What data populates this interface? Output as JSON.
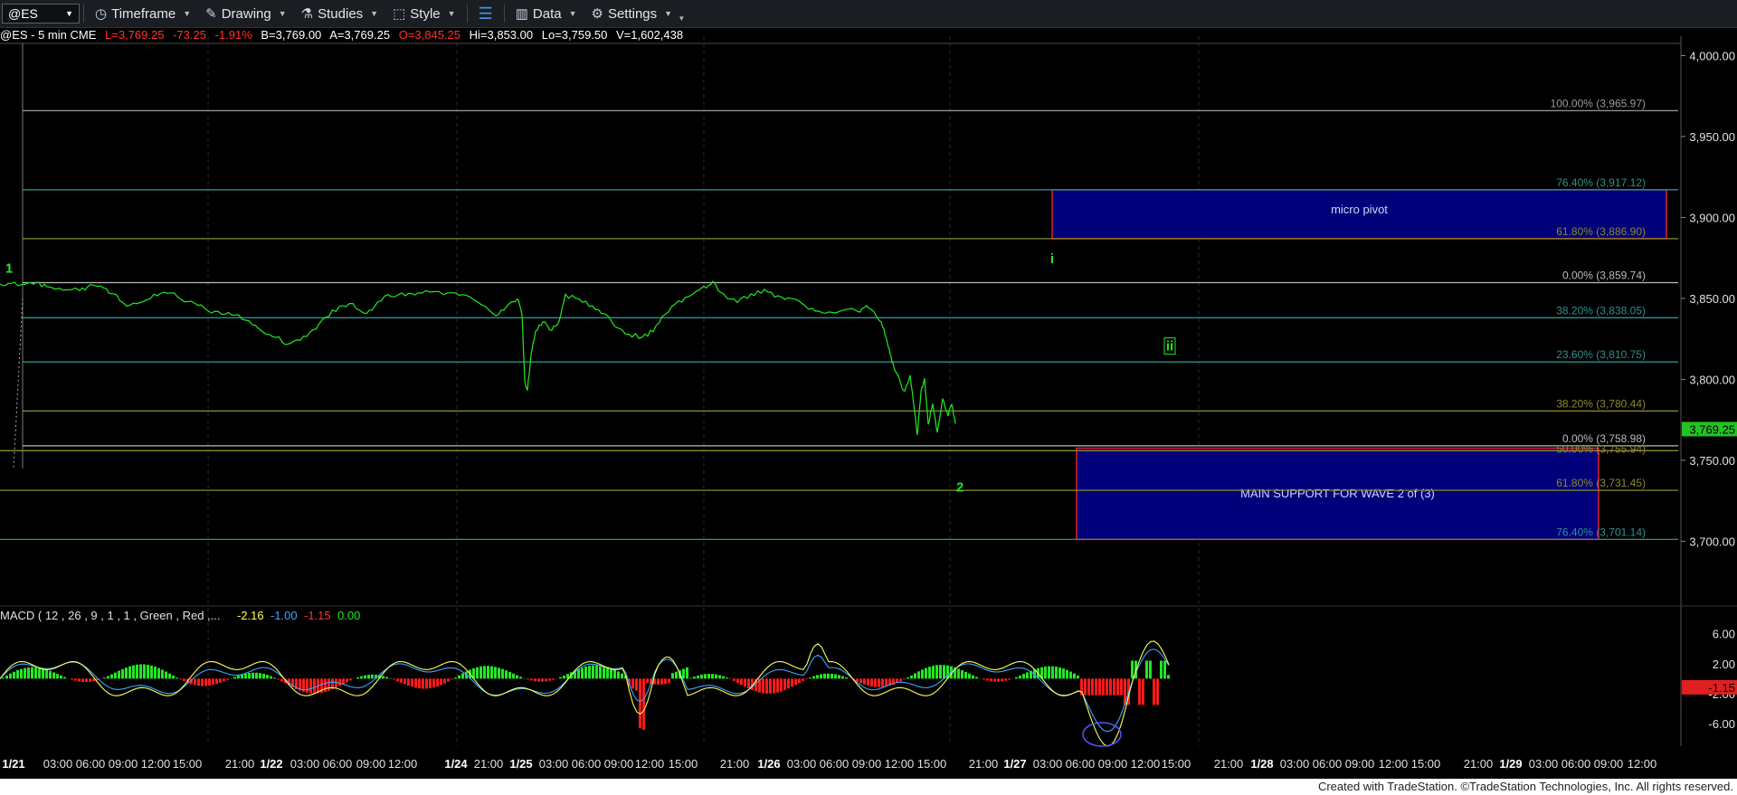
{
  "toolbar": {
    "symbol": "@ES",
    "items": [
      {
        "label": "Timeframe",
        "icon": "clock-icon"
      },
      {
        "label": "Drawing",
        "icon": "pencil-icon"
      },
      {
        "label": "Studies",
        "icon": "flask-icon"
      },
      {
        "label": "Style",
        "icon": "style-icon"
      },
      {
        "label": "Data",
        "icon": "bar-data-icon"
      },
      {
        "label": "Settings",
        "icon": "gear-icon"
      }
    ]
  },
  "status": {
    "title": "@ES - 5 min  CME",
    "last": "L=3,769.25",
    "change": "-73.25",
    "pct": "-1.91%",
    "bid": "B=3,769.00",
    "ask": "A=3,769.25",
    "open": "O=3,845.25",
    "high": "Hi=3,853.00",
    "low": "Lo=3,759.50",
    "volume": "V=1,602,438"
  },
  "colors": {
    "price_line": "#22e822",
    "macd_line": "#ffff55",
    "signal_line": "#3aa6ff",
    "hist_pos": "#22e822",
    "hist_neg": "#ff1a1a",
    "box_fill": "#00008b",
    "box_border": "#e0202a",
    "fib_teal": "#2f8f8f",
    "fib_olive": "#8a8a30"
  },
  "chart_data": {
    "type": "line",
    "title": "@ES - 5 min  CME",
    "ylim": [
      3660,
      4012
    ],
    "y_ticks": [
      "4,000.00",
      "3,950.00",
      "3,900.00",
      "3,850.00",
      "3,800.00",
      "3,750.00",
      "3,700.00"
    ],
    "y_tick_values": [
      4000,
      3950,
      3900,
      3850,
      3800,
      3750,
      3700
    ],
    "last_price_label": "3,769.25",
    "x_tick_labels": [
      "1/21",
      "03:00",
      "06:00",
      "09:00",
      "12:00",
      "15:00",
      "21:00",
      "1/22",
      "03:00",
      "06:00",
      "09:00",
      "12:00",
      "1/24",
      "21:00",
      "1/25",
      "03:00",
      "06:00",
      "09:00",
      "12:00",
      "15:00",
      "21:00",
      "1/26",
      "03:00",
      "06:00",
      "09:00",
      "12:00",
      "15:00",
      "21:00",
      "1/27",
      "03:00",
      "06:00",
      "09:00",
      "12:00",
      "15:00",
      "21:00",
      "1/28",
      "03:00",
      "06:00",
      "09:00",
      "12:00",
      "15:00",
      "21:00",
      "1/29",
      "03:00",
      "06:00",
      "09:00",
      "12:00"
    ],
    "series": [
      {
        "values": [
          [
            0,
            3858
          ],
          [
            12,
            3860
          ],
          [
            28,
            3858
          ],
          [
            40,
            3860
          ],
          [
            52,
            3857
          ],
          [
            70,
            3855
          ],
          [
            88,
            3855
          ],
          [
            100,
            3858
          ],
          [
            115,
            3856
          ],
          [
            125,
            3853
          ],
          [
            140,
            3846
          ],
          [
            155,
            3848
          ],
          [
            170,
            3852
          ],
          [
            185,
            3854
          ],
          [
            200,
            3850
          ],
          [
            215,
            3847
          ],
          [
            230,
            3843
          ],
          [
            245,
            3840
          ],
          [
            260,
            3840
          ],
          [
            275,
            3836
          ],
          [
            290,
            3830
          ],
          [
            305,
            3826
          ],
          [
            318,
            3822
          ],
          [
            332,
            3824
          ],
          [
            346,
            3830
          ],
          [
            360,
            3838
          ],
          [
            375,
            3845
          ],
          [
            390,
            3846
          ],
          [
            405,
            3840
          ],
          [
            418,
            3848
          ],
          [
            432,
            3852
          ],
          [
            448,
            3852
          ],
          [
            462,
            3853
          ],
          [
            480,
            3854
          ],
          [
            500,
            3853
          ],
          [
            515,
            3852
          ],
          [
            532,
            3847
          ],
          [
            548,
            3840
          ],
          [
            560,
            3845
          ],
          [
            572,
            3850
          ],
          [
            577,
            3840
          ],
          [
            580,
            3800
          ],
          [
            583,
            3793
          ],
          [
            587,
            3815
          ],
          [
            592,
            3830
          ],
          [
            600,
            3836
          ],
          [
            610,
            3830
          ],
          [
            618,
            3836
          ],
          [
            625,
            3852
          ],
          [
            640,
            3849
          ],
          [
            655,
            3845
          ],
          [
            668,
            3840
          ],
          [
            680,
            3833
          ],
          [
            695,
            3828
          ],
          [
            710,
            3826
          ],
          [
            722,
            3830
          ],
          [
            735,
            3840
          ],
          [
            750,
            3848
          ],
          [
            765,
            3852
          ],
          [
            778,
            3857
          ],
          [
            788,
            3860
          ],
          [
            800,
            3852
          ],
          [
            815,
            3848
          ],
          [
            830,
            3852
          ],
          [
            845,
            3855
          ],
          [
            860,
            3851
          ],
          [
            875,
            3850
          ],
          [
            890,
            3845
          ],
          [
            905,
            3842
          ],
          [
            920,
            3841
          ],
          [
            935,
            3843
          ],
          [
            948,
            3842
          ],
          [
            958,
            3845
          ],
          [
            966,
            3841
          ],
          [
            974,
            3835
          ],
          [
            980,
            3825
          ],
          [
            984,
            3815
          ],
          [
            988,
            3808
          ],
          [
            994,
            3800
          ],
          [
            1000,
            3792
          ],
          [
            1006,
            3803
          ],
          [
            1011,
            3780
          ],
          [
            1014,
            3765
          ],
          [
            1018,
            3792
          ],
          [
            1022,
            3800
          ],
          [
            1026,
            3772
          ],
          [
            1031,
            3785
          ],
          [
            1036,
            3767
          ],
          [
            1042,
            3788
          ],
          [
            1048,
            3778
          ],
          [
            1052,
            3785
          ],
          [
            1056,
            3772
          ]
        ]
      }
    ],
    "fibonacci": [
      {
        "label": "100.00% (3,965.97)",
        "value": 3965.97,
        "color": "#9a9a9a"
      },
      {
        "label": "76.40% (3,917.12)",
        "value": 3917.12,
        "color": "#2f8f8f"
      },
      {
        "label": "61.80% (3,886.90)",
        "value": 3886.9,
        "color": "#8a8a30"
      },
      {
        "label": "0.00% (3,859.74)",
        "value": 3859.74,
        "color": "#bbbbbb"
      },
      {
        "label": "38.20% (3,838.05)",
        "value": 3838.05,
        "color": "#2f8f8f"
      },
      {
        "label": "23.60% (3,810.75)",
        "value": 3810.75,
        "color": "#2f8f8f"
      },
      {
        "label": "38.20% (3,780.44)",
        "value": 3780.44,
        "color": "#8a8a30"
      },
      {
        "label": "0.00% (3,758.98)",
        "value": 3758.98,
        "color": "#bbbbbb"
      },
      {
        "label": "50.00% (3,755.94)",
        "value": 3755.94,
        "color": "#8a8a30"
      },
      {
        "label": "61.80% (3,731.45)",
        "value": 3731.45,
        "color": "#8a8a30"
      },
      {
        "label": "76.40% (3,701.14)",
        "value": 3701.14,
        "color": "#2f8f8f"
      }
    ],
    "zones": [
      {
        "label": "micro pivot",
        "from": 3886.9,
        "to": 3917.12
      },
      {
        "label": "MAIN SUPPORT FOR WAVE 2 of (3)",
        "from": 3701.14,
        "to": 3757.5
      }
    ],
    "wave_labels": [
      {
        "text": "1",
        "price": 3868,
        "x": 10
      },
      {
        "text": "i",
        "price": 3874,
        "x": 1163
      },
      {
        "text": "ii",
        "price": 3820,
        "x": 1293
      },
      {
        "text": "2",
        "price": 3733,
        "x": 1061
      }
    ]
  },
  "macd": {
    "label": "MACD ( 12 , 26 , 9 , 1 , 1 , Green , Red ,...",
    "values": [
      "-2.16",
      "-1.00",
      "-1.15",
      "0.00"
    ],
    "ylim": [
      -9,
      8
    ],
    "y_ticks": [
      "6.00",
      "2.00",
      "-2.00",
      "-6.00"
    ],
    "y_tick_values": [
      6,
      2,
      -2,
      -6
    ],
    "last_label": "-1.15"
  },
  "footer": "Created with TradeStation. ©TradeStation Technologies, Inc. All rights reserved."
}
